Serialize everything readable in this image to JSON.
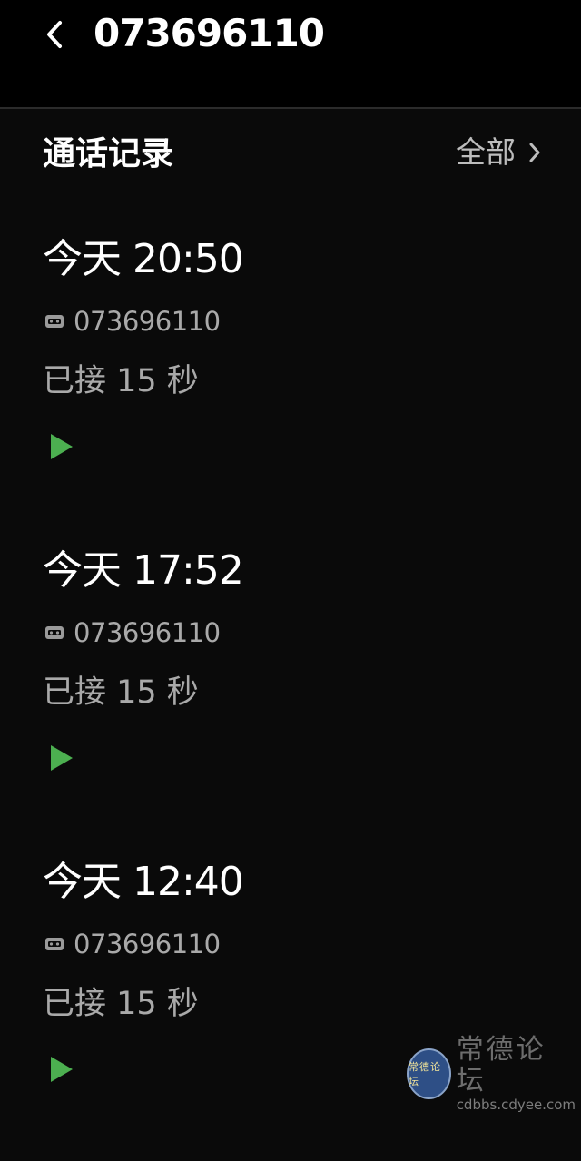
{
  "header": {
    "title": "073696110",
    "back_icon": "chevron-left-icon"
  },
  "section": {
    "title": "通话记录",
    "all_label": "全部",
    "all_icon": "chevron-right-icon"
  },
  "calls": [
    {
      "time": "今天 20:50",
      "number": "073696110",
      "status": "已接 15 秒"
    },
    {
      "time": "今天 17:52",
      "number": "073696110",
      "status": "已接 15 秒"
    },
    {
      "time": "今天 12:40",
      "number": "073696110",
      "status": "已接 15 秒"
    }
  ],
  "icons": {
    "sim": "sim-card-icon",
    "play": "play-icon"
  },
  "colors": {
    "background": "#0a0a0a",
    "header_background": "#000000",
    "primary_text": "#ffffff",
    "secondary_text": "#a9a9a9",
    "play_accent": "#4caf50"
  },
  "watermark": {
    "logo_text": "常德论坛",
    "text": "常德论坛",
    "url": "cdbbs.cdyee.com"
  }
}
